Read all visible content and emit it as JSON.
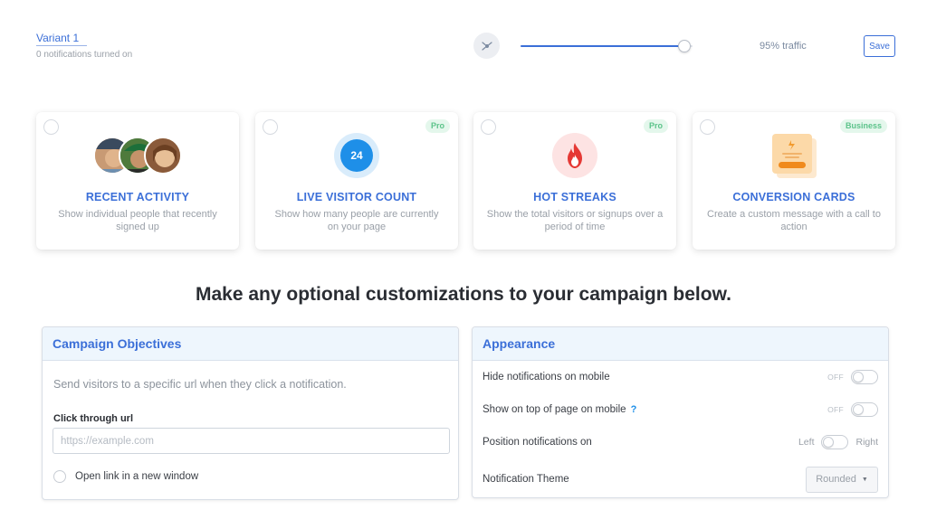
{
  "variant": {
    "name": "Variant 1",
    "notifications_status": "0 notifications turned on"
  },
  "traffic": {
    "percent": 95,
    "label": "95% traffic",
    "icon": "split-traffic-icon"
  },
  "toolbar": {
    "save_label": "Save"
  },
  "cards": [
    {
      "title": "RECENT ACTIVITY",
      "description": "Show individual people that recently signed up",
      "badge": "",
      "visual": "avatar-group"
    },
    {
      "title": "LIVE VISITOR COUNT",
      "description": "Show how many people are currently on your page",
      "badge": "Pro",
      "visual": "visitor-count",
      "count": "24"
    },
    {
      "title": "HOT STREAKS",
      "description": "Show the total visitors or signups over a period of time",
      "badge": "Pro",
      "visual": "flame-icon"
    },
    {
      "title": "CONVERSION CARDS",
      "description": "Create a custom message with a call to action",
      "badge": "Business",
      "visual": "conversion-card-icon"
    }
  ],
  "heading": "Make any optional customizations to your campaign below.",
  "objectives": {
    "title": "Campaign Objectives",
    "description": "Send visitors to a specific url when they click a notification.",
    "url_label": "Click through url",
    "url_value": "",
    "url_placeholder": "https://example.com",
    "new_window_label": "Open link in a new window"
  },
  "appearance": {
    "title": "Appearance",
    "hide_mobile": {
      "label": "Hide notifications on mobile",
      "state": "OFF"
    },
    "top_mobile": {
      "label": "Show on top of page on mobile",
      "help": "?",
      "state": "OFF"
    },
    "position": {
      "label": "Position notifications on",
      "left": "Left",
      "right": "Right"
    },
    "theme": {
      "label": "Notification Theme",
      "value": "Rounded"
    }
  },
  "colors": {
    "accent": "#3b6fd8",
    "badge_green": "#5cc38a",
    "visitor_blue": "#1e8fe8",
    "flame_red": "#e53935"
  }
}
